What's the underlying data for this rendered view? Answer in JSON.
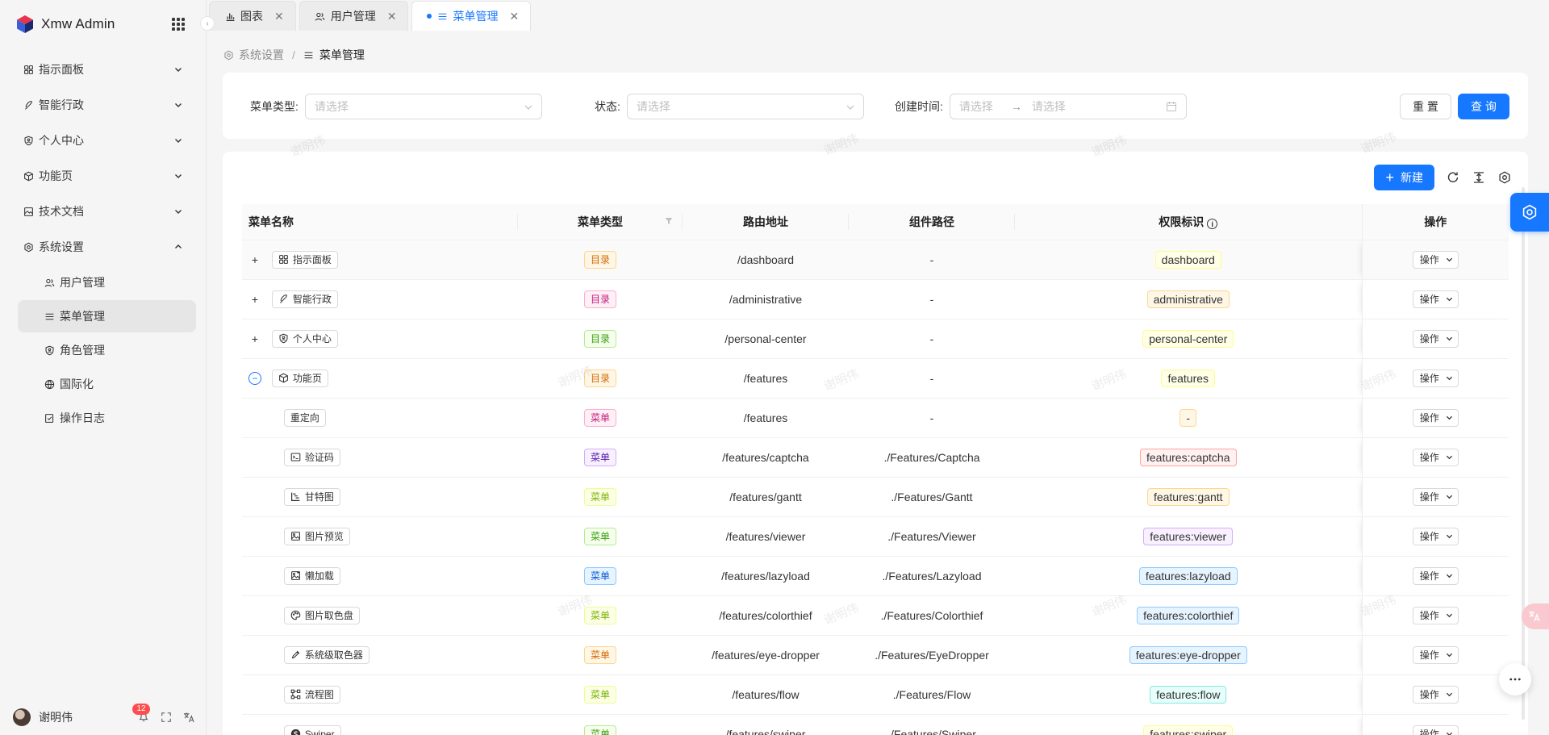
{
  "app": {
    "title": "Xmw Admin"
  },
  "sidebar": {
    "menus": [
      {
        "label": "指示面板",
        "icon": "dashboard-icon"
      },
      {
        "label": "智能行政",
        "icon": "feather-icon"
      },
      {
        "label": "个人中心",
        "icon": "shield-user-icon"
      },
      {
        "label": "功能页",
        "icon": "box-icon"
      },
      {
        "label": "技术文档",
        "icon": "image-doc-icon"
      },
      {
        "label": "系统设置",
        "icon": "settings-icon",
        "expanded": true
      }
    ],
    "submenus": [
      {
        "label": "用户管理",
        "icon": "users-icon"
      },
      {
        "label": "菜单管理",
        "icon": "menu-icon",
        "active": true
      },
      {
        "label": "角色管理",
        "icon": "role-icon"
      },
      {
        "label": "国际化",
        "icon": "globe-icon"
      },
      {
        "label": "操作日志",
        "icon": "log-icon"
      }
    ],
    "user": {
      "name": "谢明伟"
    },
    "notifications": "12"
  },
  "tabs": [
    {
      "label": "图表",
      "icon": "bar-chart-icon"
    },
    {
      "label": "用户管理",
      "icon": "users-icon"
    },
    {
      "label": "菜单管理",
      "icon": "menu-icon",
      "active": true
    }
  ],
  "breadcrumb": {
    "parent": "系统设置",
    "current": "菜单管理"
  },
  "search": {
    "menu_type_label": "菜单类型:",
    "menu_type_placeholder": "请选择",
    "status_label": "状态:",
    "status_placeholder": "请选择",
    "created_label": "创建时间:",
    "start_placeholder": "请选择",
    "end_placeholder": "请选择",
    "reset_label": "重 置",
    "query_label": "查 询"
  },
  "toolbar": {
    "new_label": "新建"
  },
  "table": {
    "headers": {
      "name": "菜单名称",
      "type": "菜单类型",
      "path": "路由地址",
      "component": "组件路径",
      "permission": "权限标识",
      "actions": "操作"
    },
    "rows": [
      {
        "name": "指示面板",
        "icon": "dashboard-icon",
        "expand": "+",
        "type": "目录",
        "type_color": "orange",
        "path": "/dashboard",
        "component": "-",
        "permission": "dashboard",
        "perm_color": "yellow"
      },
      {
        "name": "智能行政",
        "icon": "feather-icon",
        "expand": "+",
        "type": "目录",
        "type_color": "magenta",
        "path": "/administrative",
        "component": "-",
        "permission": "administrative",
        "perm_color": "orange"
      },
      {
        "name": "个人中心",
        "icon": "shield-user-icon",
        "expand": "+",
        "type": "目录",
        "type_color": "green",
        "path": "/personal-center",
        "component": "-",
        "permission": "personal-center",
        "perm_color": "yellow"
      },
      {
        "name": "功能页",
        "icon": "box-icon",
        "expand": "−",
        "type": "目录",
        "type_color": "orange",
        "path": "/features",
        "component": "-",
        "permission": "features",
        "perm_color": "yellow"
      },
      {
        "name": "重定向",
        "icon": "",
        "expand": "",
        "type": "菜单",
        "type_color": "magenta",
        "path": "/features",
        "component": "-",
        "permission": "-",
        "perm_color": "orange"
      },
      {
        "name": "验证码",
        "icon": "terminal-icon",
        "expand": "",
        "type": "菜单",
        "type_color": "purple",
        "path": "/features/captcha",
        "component": "./Features/Captcha",
        "permission": "features:captcha",
        "perm_color": "red"
      },
      {
        "name": "甘特图",
        "icon": "gantt-icon",
        "expand": "",
        "type": "菜单",
        "type_color": "lime",
        "path": "/features/gantt",
        "component": "./Features/Gantt",
        "permission": "features:gantt",
        "perm_color": "orange"
      },
      {
        "name": "图片预览",
        "icon": "picture-icon",
        "expand": "",
        "type": "菜单",
        "type_color": "green",
        "path": "/features/viewer",
        "component": "./Features/Viewer",
        "permission": "features:viewer",
        "perm_color": "purple"
      },
      {
        "name": "懒加载",
        "icon": "picture-add-icon",
        "expand": "",
        "type": "菜单",
        "type_color": "blue",
        "path": "/features/lazyload",
        "component": "./Features/Lazyload",
        "permission": "features:lazyload",
        "perm_color": "blue"
      },
      {
        "name": "图片取色盘",
        "icon": "palette-icon",
        "expand": "",
        "type": "菜单",
        "type_color": "lime",
        "path": "/features/colorthief",
        "component": "./Features/Colorthief",
        "permission": "features:colorthief",
        "perm_color": "blue"
      },
      {
        "name": "系统级取色器",
        "icon": "eyedropper-icon",
        "expand": "",
        "type": "菜单",
        "type_color": "orange",
        "path": "/features/eye-dropper",
        "component": "./Features/EyeDropper",
        "permission": "features:eye-dropper",
        "perm_color": "blue"
      },
      {
        "name": "流程图",
        "icon": "flow-icon",
        "expand": "",
        "type": "菜单",
        "type_color": "lime",
        "path": "/features/flow",
        "component": "./Features/Flow",
        "permission": "features:flow",
        "perm_color": "cyan"
      },
      {
        "name": "Swiper",
        "icon": "swiper-icon",
        "expand": "",
        "type": "菜单",
        "type_color": "green",
        "path": "/features/swiper",
        "component": "./Features/Swiper",
        "permission": "features:swiper",
        "perm_color": "yellow"
      }
    ],
    "action_label": "操作"
  },
  "watermark": "谢明伟",
  "colors": {
    "primary": "#1677ff",
    "orange": [
      "#fff7e6",
      "#ffd591",
      "#d46b08"
    ],
    "magenta": [
      "#fff0f6",
      "#ffadd2",
      "#c41d7f"
    ],
    "green": [
      "#f6ffed",
      "#b7eb8f",
      "#389e0d"
    ],
    "purple": [
      "#f9f0ff",
      "#d3adf7",
      "#531dab"
    ],
    "lime": [
      "#fcffe6",
      "#eaff8f",
      "#7cb305"
    ],
    "blue": [
      "#e6f4ff",
      "#91caff",
      "#0958d9"
    ],
    "red": [
      "#fff1f0",
      "#ffa39e",
      "#cf1322"
    ],
    "yellow": [
      "#feffe6",
      "#fffb8f",
      "#d4b106"
    ],
    "cyan": [
      "#e6fffb",
      "#87e8de",
      "#08979c"
    ]
  }
}
